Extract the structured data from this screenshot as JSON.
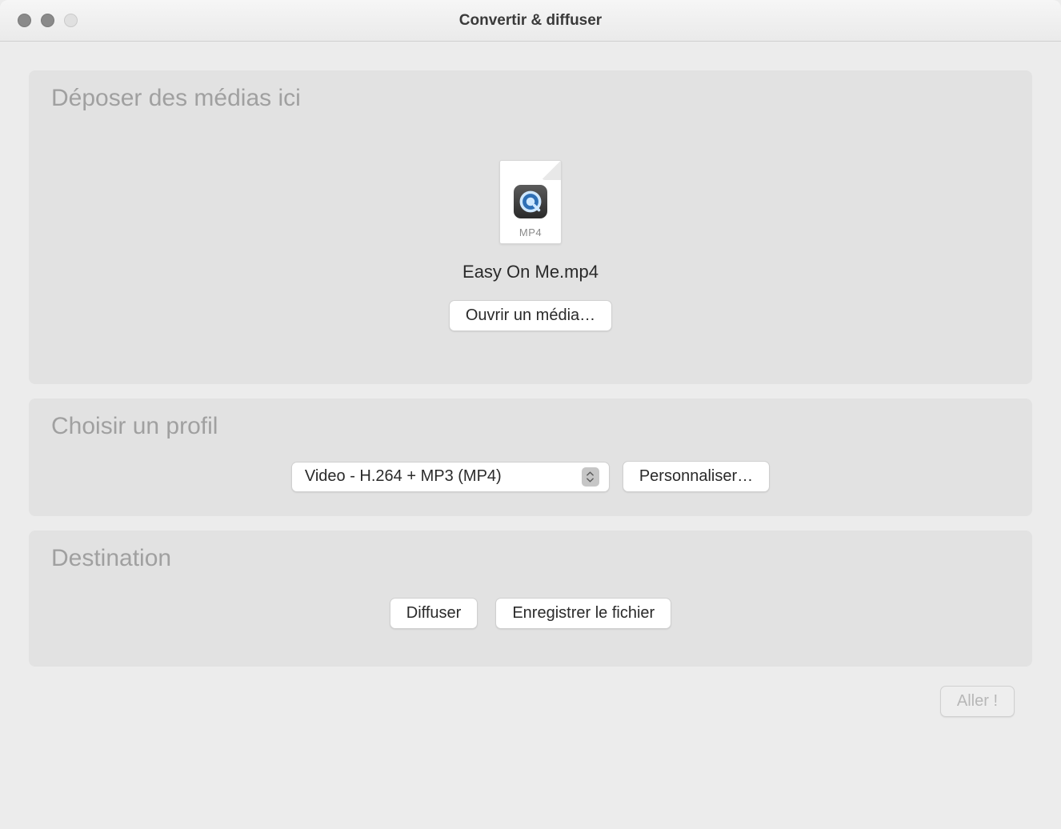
{
  "window": {
    "title": "Convertir & diffuser"
  },
  "drop": {
    "title": "Déposer des médias ici",
    "file_ext": "MP4",
    "file_name": "Easy On Me.mp4",
    "open_button": "Ouvrir un média…"
  },
  "profile": {
    "title": "Choisir un profil",
    "selected": "Video - H.264 + MP3 (MP4)",
    "customize_button": "Personnaliser…"
  },
  "destination": {
    "title": "Destination",
    "stream_button": "Diffuser",
    "save_file_button": "Enregistrer le fichier"
  },
  "footer": {
    "go_button": "Aller !"
  }
}
